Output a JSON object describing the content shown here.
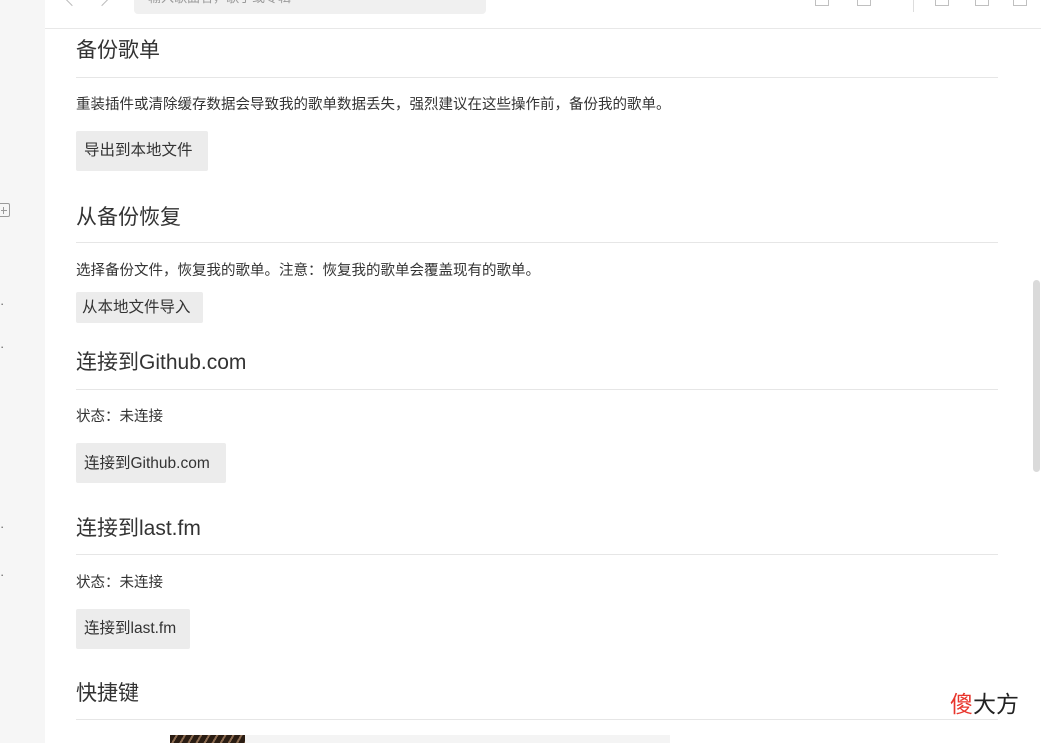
{
  "topbar": {
    "search_placeholder": "输入歌曲名，歌手或专辑"
  },
  "sections": {
    "backup": {
      "title": "备份歌单",
      "description": "重装插件或清除缓存数据会导致我的歌单数据丢失，强烈建议在这些操作前，备份我的歌单。",
      "button_label": "导出到本地文件"
    },
    "restore": {
      "title": "从备份恢复",
      "description": "选择备份文件，恢复我的歌单。注意：恢复我的歌单会覆盖现有的歌单。",
      "button_label": "从本地文件导入"
    },
    "github": {
      "title": "连接到Github.com",
      "status": "状态：未连接",
      "button_label": "连接到Github.com"
    },
    "lastfm": {
      "title": "连接到last.fm",
      "status": "状态：未连接",
      "button_label": "连接到last.fm"
    },
    "shortcuts": {
      "title": "快捷键"
    }
  },
  "watermark": {
    "red_part": "傻",
    "dark_part": "大方"
  },
  "colors": {
    "button_bg": "#ececec",
    "watermark_red": "#e8352c",
    "divider": "#e6e6e6"
  }
}
